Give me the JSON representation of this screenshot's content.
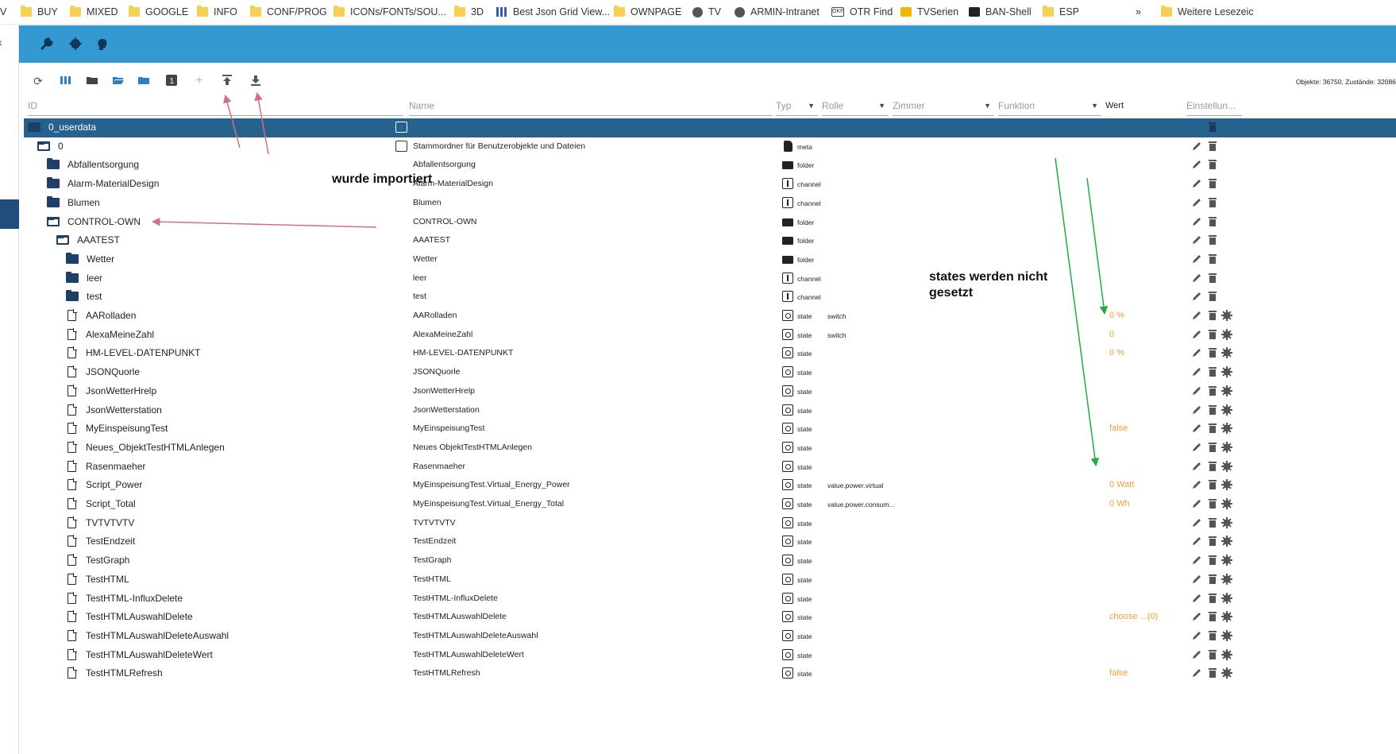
{
  "bookmarks": [
    {
      "label": "V",
      "icon": "none"
    },
    {
      "label": "BUY",
      "icon": "folder-icon"
    },
    {
      "label": "MIXED",
      "icon": "folder-icon"
    },
    {
      "label": "GOOGLE",
      "icon": "folder-icon"
    },
    {
      "label": "INFO",
      "icon": "folder-icon"
    },
    {
      "label": "CONF/PROG",
      "icon": "folder-icon"
    },
    {
      "label": "ICONs/FONTs/SOU...",
      "icon": "folder-icon"
    },
    {
      "label": "3D",
      "icon": "folder-icon"
    },
    {
      "label": "Best Json Grid View...",
      "icon": "grid-icon"
    },
    {
      "label": "OWNPAGE",
      "icon": "folder-icon"
    },
    {
      "label": "TV",
      "icon": "globe-icon"
    },
    {
      "label": "ARMIN-Intranet",
      "icon": "globe-icon"
    },
    {
      "label": "OTR Find",
      "icon": "otr-icon"
    },
    {
      "label": "TVSerien",
      "icon": "play-icon"
    },
    {
      "label": "BAN-Shell",
      "icon": "shell-icon"
    },
    {
      "label": "ESP",
      "icon": "folder-icon"
    },
    {
      "label": "»",
      "icon": "none"
    },
    {
      "label": "Weitere Lesezeic",
      "icon": "folder-icon"
    }
  ],
  "left_strip_glyph": "‹",
  "header_icons": [
    "wrench-icon",
    "gear-icon",
    "head-icon"
  ],
  "toolbar": {
    "icons": [
      "refresh-icon",
      "columns-icon",
      "folder-icon",
      "folder-open-icon",
      "folder-blue-icon",
      "number-one-icon",
      "plus-icon",
      "upload-icon",
      "download-icon"
    ],
    "counts": "Objekte: 36750, Zustände: 32086"
  },
  "columns": {
    "id": "ID",
    "name": "Name",
    "type": "Typ",
    "role": "Rolle",
    "room": "Zimmer",
    "function": "Funktion",
    "value": "Wert",
    "settings": "Einstellun..."
  },
  "rows": [
    {
      "id": "0_userdata",
      "level": 0,
      "kind": "folder-open",
      "selected": true,
      "name": "",
      "type": "",
      "role": "",
      "value": "",
      "actions": "del"
    },
    {
      "id": "0",
      "level": 1,
      "kind": "folder-open",
      "name": "Stammordner für Benutzerobjekte und Dateien",
      "type": "meta",
      "role": "",
      "value": "",
      "actions": "edit-del"
    },
    {
      "id": "Abfallentsorgung",
      "level": 2,
      "kind": "folder",
      "name": "Abfallentsorgung",
      "type": "folder",
      "role": "",
      "value": "",
      "actions": "edit-del"
    },
    {
      "id": "Alarm-MaterialDesign",
      "level": 2,
      "kind": "folder",
      "name": "Alarm-MaterialDesign",
      "type": "channel",
      "role": "",
      "value": "",
      "actions": "edit-del"
    },
    {
      "id": "Blumen",
      "level": 2,
      "kind": "folder",
      "name": "Blumen",
      "type": "channel",
      "role": "",
      "value": "",
      "actions": "edit-del"
    },
    {
      "id": "CONTROL-OWN",
      "level": 2,
      "kind": "folder-open",
      "name": "CONTROL-OWN",
      "type": "folder",
      "role": "",
      "value": "",
      "actions": "edit-del"
    },
    {
      "id": "AAATEST",
      "level": 3,
      "kind": "folder-open",
      "name": "AAATEST",
      "type": "folder",
      "role": "",
      "value": "",
      "actions": "edit-del"
    },
    {
      "id": "Wetter",
      "level": 4,
      "kind": "folder",
      "name": "Wetter",
      "type": "folder",
      "role": "",
      "value": "",
      "actions": "edit-del"
    },
    {
      "id": "leer",
      "level": 4,
      "kind": "folder",
      "name": "leer",
      "type": "channel",
      "role": "",
      "value": "",
      "actions": "edit-del"
    },
    {
      "id": "test",
      "level": 4,
      "kind": "folder",
      "name": "test",
      "type": "channel",
      "role": "",
      "value": "",
      "actions": "edit-del"
    },
    {
      "id": "AARolladen",
      "level": 4,
      "kind": "doc",
      "name": "AARolladen",
      "type": "state",
      "role": "switch",
      "value": "0 %",
      "actions": "edit-del-gear"
    },
    {
      "id": "AlexaMeineZahl",
      "level": 4,
      "kind": "doc",
      "name": "AlexaMeineZahl",
      "type": "state",
      "role": "switch",
      "value": "0",
      "actions": "edit-del-gear"
    },
    {
      "id": "HM-LEVEL-DATENPUNKT",
      "level": 4,
      "kind": "doc",
      "name": "HM-LEVEL-DATENPUNKT",
      "type": "state",
      "role": "",
      "value": "0 %",
      "actions": "edit-del-gear"
    },
    {
      "id": "JSONQuorle",
      "level": 4,
      "kind": "doc",
      "name": "JSONQuorle",
      "type": "state",
      "role": "",
      "value": "",
      "actions": "edit-del-gear"
    },
    {
      "id": "JsonWetterHrelp",
      "level": 4,
      "kind": "doc",
      "name": "JsonWetterHrelp",
      "type": "state",
      "role": "",
      "value": "",
      "actions": "edit-del-gear"
    },
    {
      "id": "JsonWetterstation",
      "level": 4,
      "kind": "doc",
      "name": "JsonWetterstation",
      "type": "state",
      "role": "",
      "value": "",
      "actions": "edit-del-gear"
    },
    {
      "id": "MyEinspeisungTest",
      "level": 4,
      "kind": "doc",
      "name": "MyEinspeisungTest",
      "type": "state",
      "role": "",
      "value": "false",
      "actions": "edit-del-gear"
    },
    {
      "id": "Neues_ObjektTestHTMLAnlegen",
      "level": 4,
      "kind": "doc",
      "name": "Neues ObjektTestHTMLAnlegen",
      "type": "state",
      "role": "",
      "value": "",
      "actions": "edit-del-gear"
    },
    {
      "id": "Rasenmaeher",
      "level": 4,
      "kind": "doc",
      "name": "Rasenmaeher",
      "type": "state",
      "role": "",
      "value": "",
      "actions": "edit-del-gear"
    },
    {
      "id": "Script_Power",
      "level": 4,
      "kind": "doc",
      "name": "MyEinspeisungTest.Virtual_Energy_Power",
      "type": "state",
      "role": "value.power.virtual",
      "value": "0 Watt",
      "actions": "edit-del-gear"
    },
    {
      "id": "Script_Total",
      "level": 4,
      "kind": "doc",
      "name": "MyEinspeisungTest.Virtual_Energy_Total",
      "type": "state",
      "role": "value.power.consum...",
      "value": "0 Wh",
      "actions": "edit-del-gear"
    },
    {
      "id": "TVTVTVTV",
      "level": 4,
      "kind": "doc",
      "name": "TVTVTVTV",
      "type": "state",
      "role": "",
      "value": "",
      "actions": "edit-del-gear"
    },
    {
      "id": "TestEndzeit",
      "level": 4,
      "kind": "doc",
      "name": "TestEndzeit",
      "type": "state",
      "role": "",
      "value": "",
      "actions": "edit-del-gear"
    },
    {
      "id": "TestGraph",
      "level": 4,
      "kind": "doc",
      "name": "TestGraph",
      "type": "state",
      "role": "",
      "value": "",
      "actions": "edit-del-gear"
    },
    {
      "id": "TestHTML",
      "level": 4,
      "kind": "doc",
      "name": "TestHTML",
      "type": "state",
      "role": "",
      "value": "",
      "actions": "edit-del-gear"
    },
    {
      "id": "TestHTML-InfluxDelete",
      "level": 4,
      "kind": "doc",
      "name": "TestHTML-InfluxDelete",
      "type": "state",
      "role": "",
      "value": "",
      "actions": "edit-del-gear"
    },
    {
      "id": "TestHTMLAuswahlDelete",
      "level": 4,
      "kind": "doc",
      "name": "TestHTMLAuswahlDelete",
      "type": "state",
      "role": "",
      "value": "choose ...(0)",
      "actions": "edit-del-gear"
    },
    {
      "id": "TestHTMLAuswahlDeleteAuswahl",
      "level": 4,
      "kind": "doc",
      "name": "TestHTMLAuswahlDeleteAuswahl",
      "type": "state",
      "role": "",
      "value": "",
      "actions": "edit-del-gear"
    },
    {
      "id": "TestHTMLAuswahlDeleteWert",
      "level": 4,
      "kind": "doc",
      "name": "TestHTMLAuswahlDeleteWert",
      "type": "state",
      "role": "",
      "value": "",
      "actions": "edit-del-gear"
    },
    {
      "id": "TestHTMLRefresh",
      "level": 4,
      "kind": "doc",
      "name": "TestHTMLRefresh",
      "type": "state",
      "role": "",
      "value": "false",
      "actions": "edit-del-gear"
    }
  ],
  "annotations": {
    "imported": "wurde importiert",
    "states_not_set": "states werden nicht gesetzt"
  },
  "colors": {
    "header": "#3599d1",
    "selected_row": "#27628f",
    "folder_icon": "#1e3f6a",
    "value_text": "#f0a030",
    "arrow_red": "#d07080",
    "arrow_green": "#22aa44"
  }
}
